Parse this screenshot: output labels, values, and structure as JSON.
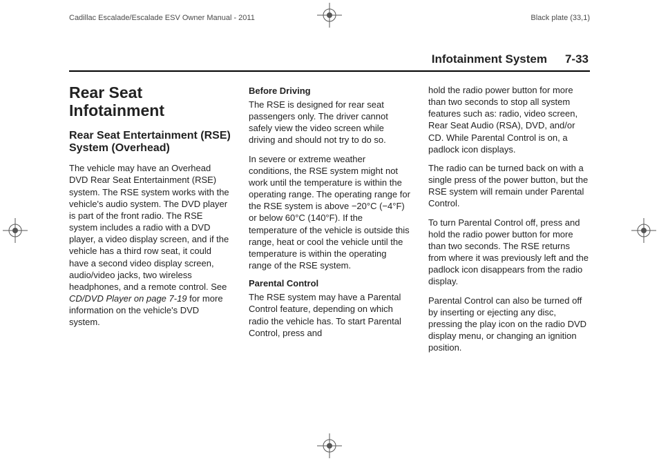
{
  "meta": {
    "doc_title": "Cadillac Escalade/Escalade ESV Owner Manual - 2011",
    "plate": "Black plate (33,1)"
  },
  "runhead": {
    "title": "Infotainment System",
    "page": "7-33"
  },
  "col1": {
    "h1": "Rear Seat Infotainment",
    "h2": "Rear Seat Entertainment (RSE) System (Overhead)",
    "p1a": "The vehicle may have an Overhead DVD Rear Seat Entertainment (RSE) system. The RSE system works with the vehicle's audio system. The DVD player is part of the front radio. The RSE system includes a radio with a DVD player, a video display screen, and if the vehicle has a third row seat, it could have a second video display screen, audio/video jacks, two wireless headphones, and a remote control. See ",
    "p1i": "CD/DVD Player on page 7-19",
    "p1b": " for more information on the vehicle's DVD system."
  },
  "col2": {
    "h3a": "Before Driving",
    "p1": "The RSE is designed for rear seat passengers only. The driver cannot safely view the video screen while driving and should not try to do so.",
    "p2": "In severe or extreme weather conditions, the RSE system might not work until the temperature is within the operating range. The operating range for the RSE system is above −20°C (−4°F) or below 60°C (140°F). If the temperature of the vehicle is outside this range, heat or cool the vehicle until the temperature is within the operating range of the RSE system.",
    "h3b": "Parental Control",
    "p3": "The RSE system may have a Parental Control feature, depending on which radio the vehicle has. To start Parental Control, press and"
  },
  "col3": {
    "p1": "hold the radio power button for more than two seconds to stop all system features such as: radio, video screen, Rear Seat Audio (RSA), DVD, and/or CD. While Parental Control is on, a padlock icon displays.",
    "p2": "The radio can be turned back on with a single press of the power button, but the RSE system will remain under Parental Control.",
    "p3": "To turn Parental Control off, press and hold the radio power button for more than two seconds. The RSE returns from where it was previously left and the padlock icon disappears from the radio display.",
    "p4": "Parental Control can also be turned off by inserting or ejecting any disc, pressing the play icon on the radio DVD display menu, or changing an ignition position."
  }
}
